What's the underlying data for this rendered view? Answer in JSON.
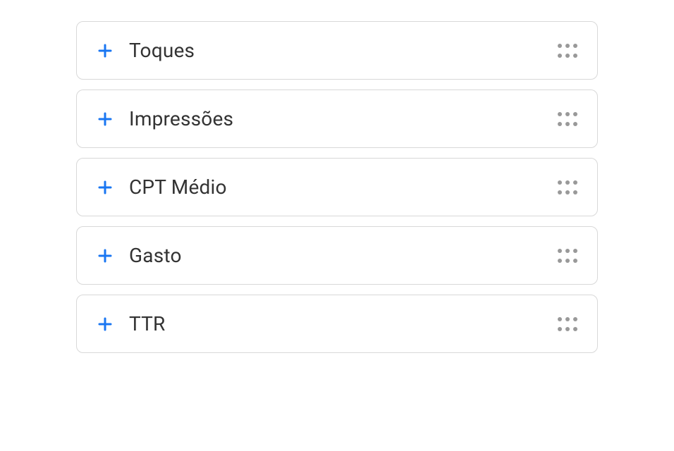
{
  "metrics": [
    {
      "label": "Toques"
    },
    {
      "label": "Impressões"
    },
    {
      "label": "CPT Médio"
    },
    {
      "label": "Gasto"
    },
    {
      "label": "TTR"
    }
  ],
  "colors": {
    "accent": "#1976f2",
    "border": "#d8d8d8",
    "text": "#333333",
    "dragDot": "#999999"
  }
}
